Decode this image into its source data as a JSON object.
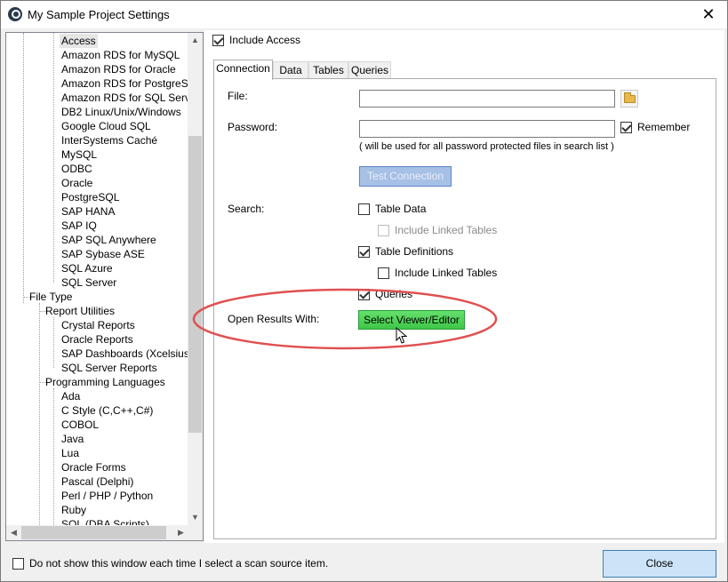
{
  "window": {
    "title": "My Sample Project Settings"
  },
  "tree": {
    "items": [
      "Access",
      "Amazon RDS for MySQL",
      "Amazon RDS for Oracle",
      "Amazon RDS for PostgreSQL",
      "Amazon RDS for SQL Server",
      "DB2 Linux/Unix/Windows",
      "Google Cloud SQL",
      "InterSystems Caché",
      "MySQL",
      "ODBC",
      "Oracle",
      "PostgreSQL",
      "SAP HANA",
      "SAP IQ",
      "SAP SQL Anywhere",
      "SAP Sybase ASE",
      "SQL Azure",
      "SQL Server",
      "File Type",
      "Report Utilities",
      "Crystal Reports",
      "Oracle Reports",
      "SAP Dashboards (Xcelsius)",
      "SQL Server Reports",
      "Programming Languages",
      "Ada",
      "C Style (C,C++,C#)",
      "COBOL",
      "Java",
      "Lua",
      "Oracle Forms",
      "Pascal (Delphi)",
      "Perl / PHP / Python",
      "Ruby",
      "SQL (DBA Scripts)"
    ],
    "selected": "Access"
  },
  "settings": {
    "include_label": "Include Access",
    "include_checked": true,
    "tabs": [
      "Connection",
      "Data",
      "Tables",
      "Queries"
    ],
    "active_tab": "Connection",
    "file_label": "File:",
    "file_value": "",
    "password_label": "Password:",
    "password_value": "",
    "remember_label": "Remember",
    "remember_checked": true,
    "password_note": "( will be used for all password protected files in search list )",
    "test_button": "Test Connection",
    "search_label": "Search:",
    "search_options": [
      {
        "label": "Table Data",
        "checked": false,
        "enabled": true
      },
      {
        "label": "Include Linked Tables",
        "checked": false,
        "enabled": false
      },
      {
        "label": "Table Definitions",
        "checked": true,
        "enabled": true
      },
      {
        "label": "Include Linked Tables",
        "checked": false,
        "enabled": true
      },
      {
        "label": "Queries",
        "checked": true,
        "enabled": true
      }
    ],
    "open_results_label": "Open Results With:",
    "viewer_button": "Select Viewer/Editor"
  },
  "footer": {
    "dont_show_label": "Do not show this window each time I select a scan source item.",
    "dont_show_checked": false,
    "close_button": "Close"
  },
  "colors": {
    "highlight_ellipse": "#e05050",
    "viewer_button": "#4fd158",
    "close_button": "#cce4f7"
  },
  "icons": {
    "app": "app-logo-icon",
    "close": "close-icon",
    "folder": "folder-icon",
    "cursor": "mouse-pointer-icon"
  }
}
